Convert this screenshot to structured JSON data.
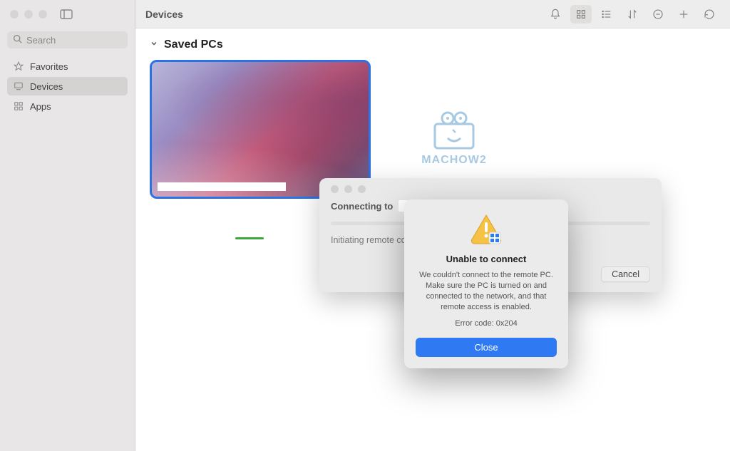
{
  "header": {
    "title": "Devices"
  },
  "search": {
    "placeholder": "Search"
  },
  "sidebar": {
    "items": [
      {
        "label": "Favorites",
        "icon": "star-icon",
        "selected": false
      },
      {
        "label": "Devices",
        "icon": "display-icon",
        "selected": true
      },
      {
        "label": "Apps",
        "icon": "grid-icon",
        "selected": false
      }
    ]
  },
  "section": {
    "title": "Saved PCs"
  },
  "watermark": {
    "text": "MACHOW2"
  },
  "sheet": {
    "connecting_label": "Connecting to",
    "status": "Initiating remote connection...",
    "cancel": "Cancel"
  },
  "dialog": {
    "title": "Unable to connect",
    "body": "We couldn't connect to the remote PC. Make sure the PC is turned on and connected to the network, and that remote access is enabled.",
    "error_code": "Error code: 0x204",
    "close": "Close"
  },
  "colors": {
    "accent": "#2f79f2",
    "selection": "#2b72e5"
  }
}
